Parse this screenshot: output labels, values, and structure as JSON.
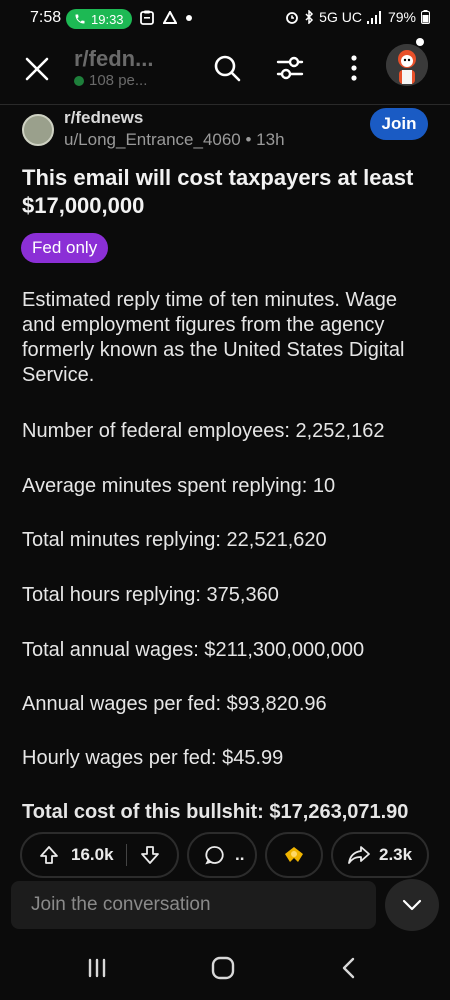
{
  "status_bar": {
    "time": "7:58",
    "call_timer": "19:33",
    "network": "5G UC",
    "battery": "79%",
    "colors": {
      "call_pill": "#1db954"
    }
  },
  "header": {
    "subreddit": "r/fedn...",
    "members": "108 pe...",
    "icons": [
      "close-icon",
      "search-icon",
      "filter-icon",
      "more-icon",
      "user-avatar"
    ]
  },
  "post": {
    "subreddit": "r/fednews",
    "author": "u/Long_Entrance_4060",
    "age": "13h",
    "join_label": "Join",
    "title": "This email will cost taxpayers at least $17,000,000",
    "flair": "Fed only",
    "body": [
      "Estimated reply time of ten minutes. Wage and employment figures from the agency formerly known as the United States Digital Service.",
      "Number of federal employees: 2,252,162",
      "Average minutes spent replying: 10",
      "Total minutes replying: 22,521,620",
      "Total hours replying: 375,360",
      "Total annual wages: $211,300,000,000",
      "Annual wages per fed: $93,820.96",
      "Hourly wages per fed: $45.99",
      "Total cost of this bullshit: $17,263,071.90"
    ],
    "colors": {
      "join": "#1a5bc4",
      "flair": "#8b2fd6"
    }
  },
  "actions": {
    "upvotes": "16.0k",
    "comments": "..",
    "shares": "2.3k",
    "award_icon": "award-icon"
  },
  "comment_bar": {
    "placeholder": "Join the conversation"
  }
}
